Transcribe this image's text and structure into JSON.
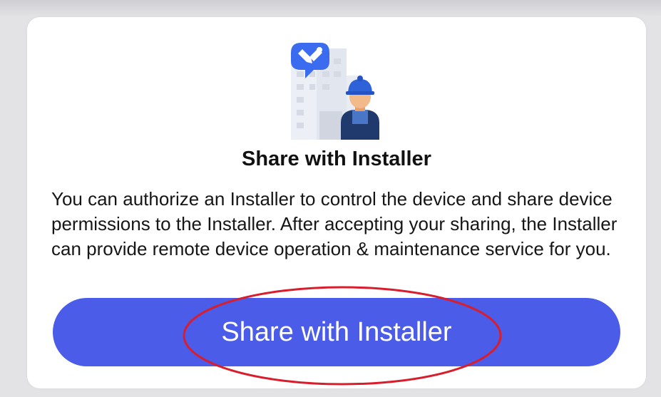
{
  "dialog": {
    "title": "Share with Installer",
    "description": "You can authorize an Installer to control the device and share device permissions to the Installer. After accepting your sharing, the Installer can provide remote device operation & maintenance service for you.",
    "primary_button_label": "Share with Installer",
    "illustration_icon": "installer-worker-icon",
    "badge_icon": "tools-icon"
  },
  "colors": {
    "accent": "#4A5CE8",
    "annotation": "#D81E2C",
    "badge": "#3B6BEF",
    "helmet": "#2E62D8"
  }
}
